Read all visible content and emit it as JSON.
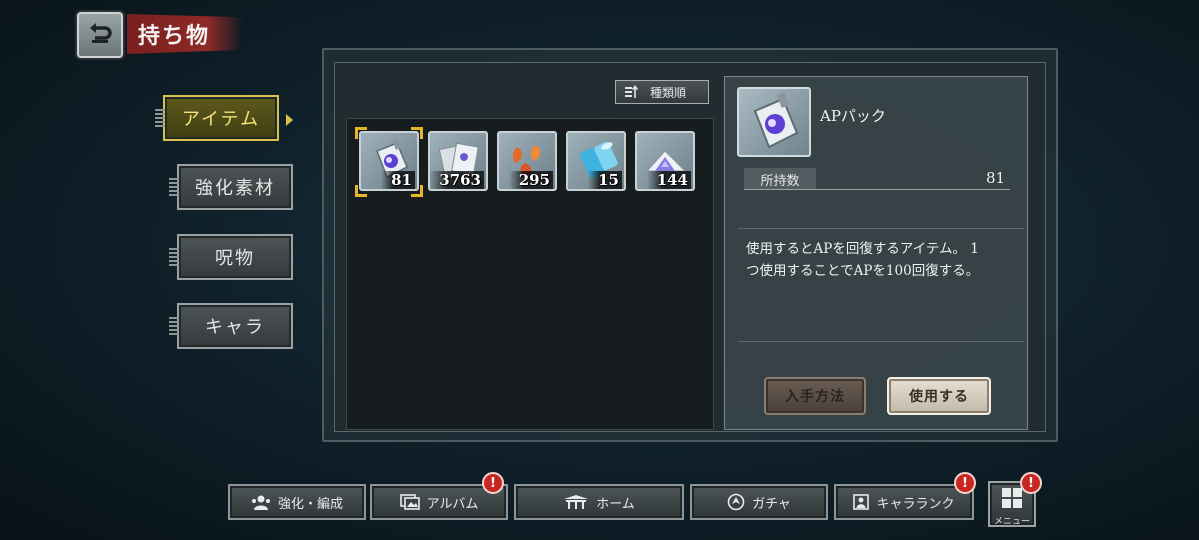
{
  "header": {
    "title": "持ち物"
  },
  "side_tabs": [
    {
      "label": "アイテム",
      "active": true
    },
    {
      "label": "強化素材",
      "active": false
    },
    {
      "label": "呪物",
      "active": false
    },
    {
      "label": "キャラ",
      "active": false
    }
  ],
  "sort": {
    "label": "種類順"
  },
  "items": [
    {
      "icon": "ap-pack-icon",
      "count": "81"
    },
    {
      "icon": "cards-icon",
      "count": "3763"
    },
    {
      "icon": "petals-icon",
      "count": "295"
    },
    {
      "icon": "film-roll-icon",
      "count": "15"
    },
    {
      "icon": "crystal-pile-icon",
      "count": "144"
    }
  ],
  "detail": {
    "name": "APパック",
    "quantity_label": "所持数",
    "quantity_value": "81",
    "description_line1": "使用するとAPを回復するアイテム。 1",
    "description_line2": "つ使用することでAPを100回復する。",
    "acquire_label": "入手方法",
    "use_label": "使用する"
  },
  "bottom_nav": {
    "enhance": "強化・編成",
    "album": "アルバム",
    "home": "ホーム",
    "gacha": "ガチャ",
    "chara_rank": "キャラランク",
    "menu": "メニュー",
    "badge": "!"
  },
  "colors": {
    "accent_gold": "#e7b62a",
    "title_red": "#8e2a27",
    "badge_red": "#c8261e",
    "background": "#10222c"
  }
}
